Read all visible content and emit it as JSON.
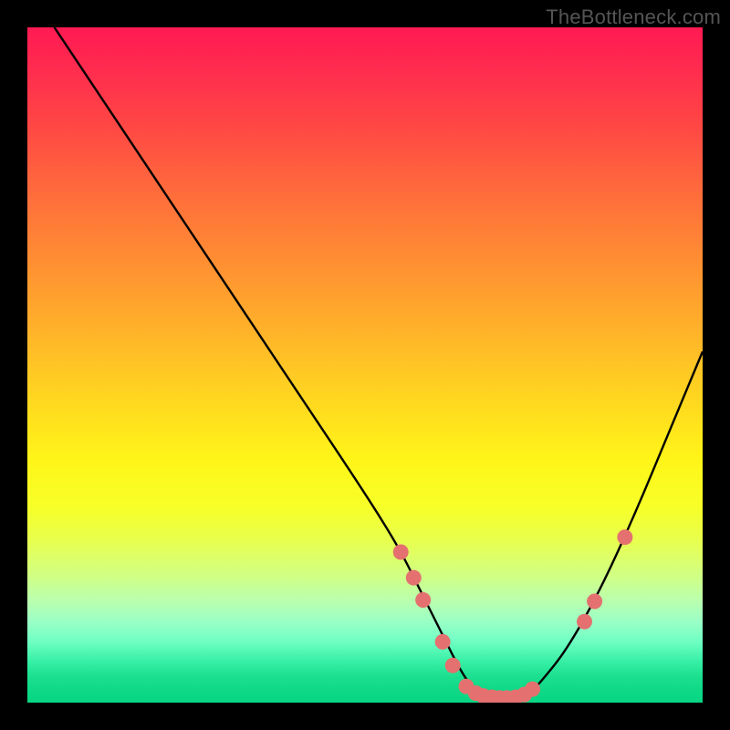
{
  "watermark": "TheBottleneck.com",
  "chart_data": {
    "type": "line",
    "title": "",
    "xlabel": "",
    "ylabel": "",
    "xlim": [
      0,
      100
    ],
    "ylim": [
      0,
      100
    ],
    "grid": false,
    "legend": false,
    "series": [
      {
        "name": "bottleneck-curve",
        "x": [
          4,
          10,
          20,
          30,
          40,
          50,
          55,
          58,
          60,
          62,
          64,
          66,
          68,
          70,
          72,
          74,
          76,
          80,
          85,
          90,
          95,
          100
        ],
        "y": [
          100,
          91,
          76,
          61,
          46,
          31,
          23,
          17,
          13,
          9,
          5,
          2,
          1,
          0.5,
          0.5,
          1,
          3,
          8,
          17,
          28,
          40,
          52
        ]
      }
    ],
    "markers": [
      {
        "x": 55.3,
        "y": 22.3
      },
      {
        "x": 57.2,
        "y": 18.5
      },
      {
        "x": 58.6,
        "y": 15.2
      },
      {
        "x": 61.5,
        "y": 9.0
      },
      {
        "x": 63.0,
        "y": 5.5
      },
      {
        "x": 65.0,
        "y": 2.4
      },
      {
        "x": 66.4,
        "y": 1.4
      },
      {
        "x": 67.5,
        "y": 1.0
      },
      {
        "x": 68.8,
        "y": 0.8
      },
      {
        "x": 69.9,
        "y": 0.7
      },
      {
        "x": 71.0,
        "y": 0.7
      },
      {
        "x": 72.3,
        "y": 0.8
      },
      {
        "x": 73.6,
        "y": 1.2
      },
      {
        "x": 74.8,
        "y": 2.0
      },
      {
        "x": 82.5,
        "y": 12.0
      },
      {
        "x": 84.0,
        "y": 15.0
      },
      {
        "x": 88.5,
        "y": 24.5
      }
    ]
  },
  "colors": {
    "marker": "#e4716f",
    "curve": "#000000",
    "frame": "#000000"
  }
}
